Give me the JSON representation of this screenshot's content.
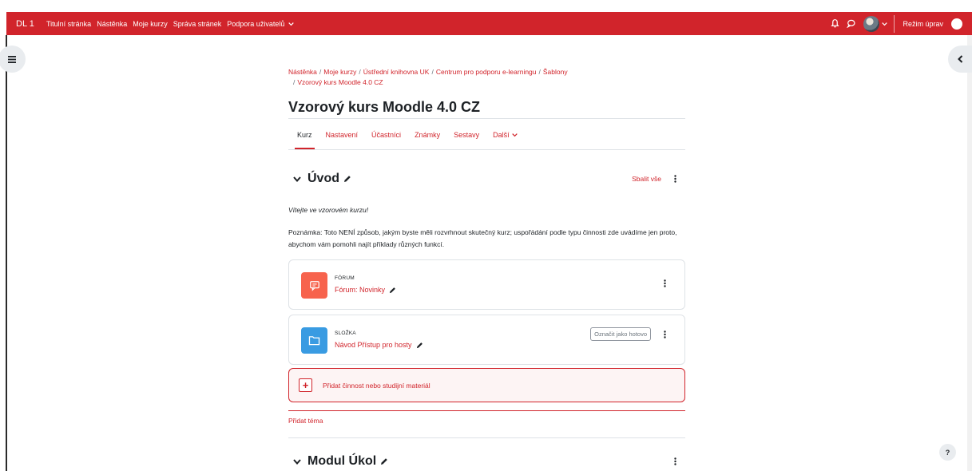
{
  "navbar": {
    "brand": "DL 1",
    "links": [
      "Titulní stránka",
      "Nástěnka",
      "Moje kurzy",
      "Správa stránek",
      "Podpora uživatelů"
    ],
    "edit_mode_label": "Režim úprav",
    "accent": "#d1242b"
  },
  "breadcrumb": [
    "Nástěnka",
    "Moje kurzy",
    "Ústřední knihovna UK",
    "Centrum pro podporu e-learningu",
    "Šablony",
    "Vzorový kurs Moodle 4.0 CZ"
  ],
  "page_title": "Vzorový kurs Moodle 4.0 CZ",
  "tabs": [
    "Kurz",
    "Nastavení",
    "Účastníci",
    "Známky",
    "Sestavy",
    "Další"
  ],
  "sections": [
    {
      "title": "Úvod",
      "collapse_all": "Sbalit vše",
      "welcome": "Vítejte ve vzorovém kurzu!",
      "note": "Poznámka: Toto NENÍ způsob, jakým byste měli rozvrhnout skutečný kurz; uspořádání podle typu činnosti zde uvádíme jen proto, abychom vám pomohli najít příklady různých funkcí.",
      "activities": [
        {
          "type": "FÓRUM",
          "name": "Fórum: Novinky",
          "icon": "forum-icon",
          "color": "#f7634d"
        },
        {
          "type": "SLOŽKA",
          "name": "Návod Přístup pro hosty",
          "icon": "folder-icon",
          "color": "#399be2",
          "mark_done": "Označit jako hotovo"
        }
      ],
      "add_activity": "Přidat činnost nebo studijní materiál",
      "add_topic": "Přidat téma"
    },
    {
      "title": "Modul Úkol"
    }
  ],
  "help": "?"
}
